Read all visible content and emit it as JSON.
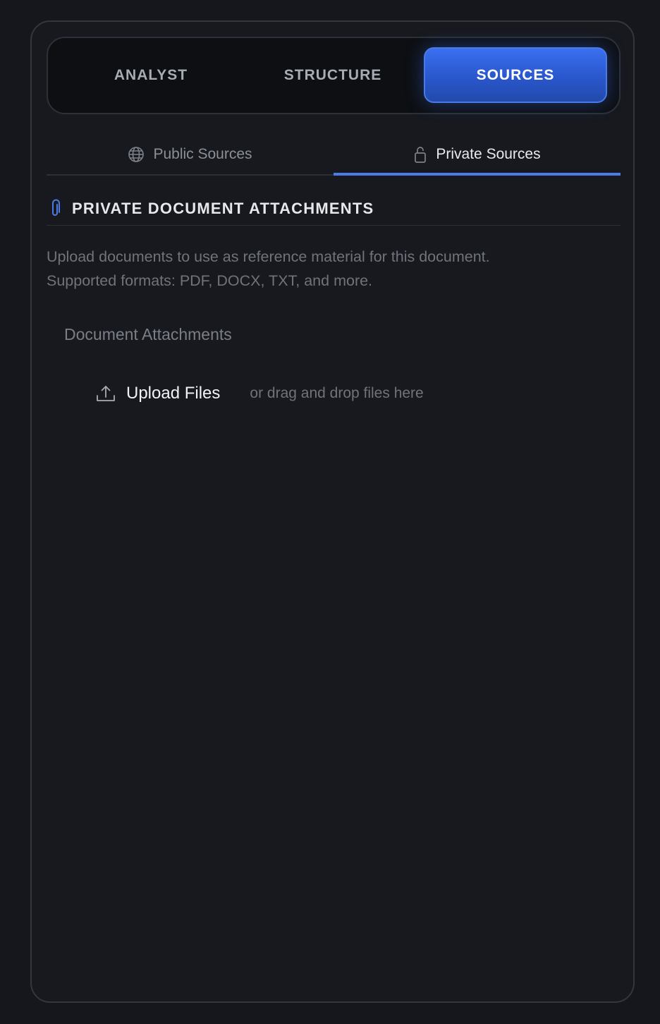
{
  "mode_tabs": {
    "analyst": "ANALYST",
    "structure": "STRUCTURE",
    "sources": "SOURCES",
    "active": "SOURCES"
  },
  "source_tabs": {
    "public": {
      "label": "Public Sources",
      "icon": "globe-icon"
    },
    "private": {
      "label": "Private Sources",
      "icon": "lock-icon"
    },
    "active": "Private Sources"
  },
  "section": {
    "icon": "paperclip-icon",
    "title": "PRIVATE DOCUMENT ATTACHMENTS",
    "description_line1": "Upload documents to use as reference material for this document.",
    "description_line2": "Supported formats: PDF, DOCX, TXT, and more."
  },
  "attachments": {
    "label": "Document Attachments",
    "upload_icon": "upload-icon",
    "upload_label": "Upload Files",
    "drop_hint": "or drag and drop files here"
  },
  "colors": {
    "accent": "#3a6ff0",
    "background": "#17191e",
    "active_underline": "#4a7be6"
  }
}
